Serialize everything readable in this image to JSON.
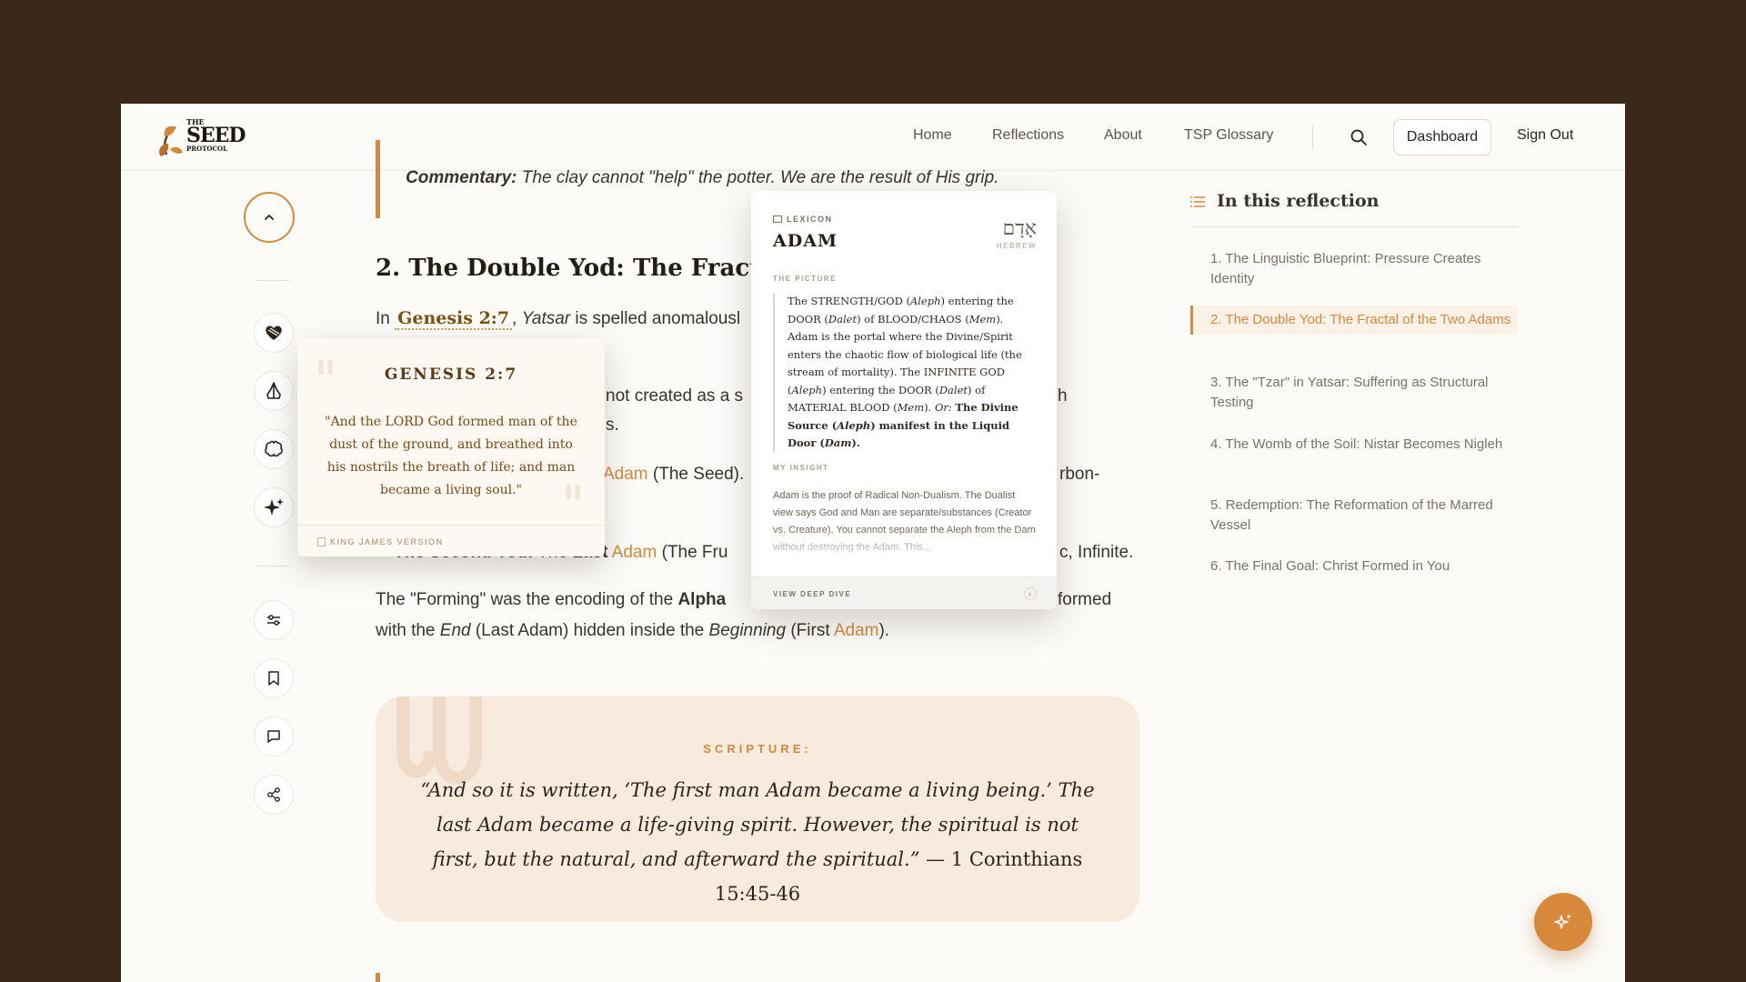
{
  "header": {
    "logo": {
      "line1": "THE",
      "line2": "SEED",
      "line3": "PROTOCOL"
    },
    "nav": [
      "Home",
      "Reflections",
      "About",
      "TSP Glossary"
    ],
    "dashboard_label": "Dashboard",
    "signout_label": "Sign Out"
  },
  "article": {
    "commentary_label": "Commentary:",
    "commentary_text": "The clay cannot \"help\" the potter. We are the result of His grip.",
    "heading": "2. The Double Yod: The Fractal o",
    "line1": {
      "pre": "In",
      "ref": "Genesis 2:7",
      "comma": ",",
      "word": "Yatsar",
      "post": "is spelled anomalousl"
    },
    "line2": {
      "a": "not created as a s",
      "b": "h"
    },
    "line3": {
      "a": "s."
    },
    "line4": {
      "adam": "Adam",
      "rest": "(The Seed).",
      "tail": "rbon-"
    },
    "line5": {
      "bullet": "•",
      "label": "The Second Yod:",
      "mid": "The",
      "last": "Last",
      "adam": "Adam",
      "rest": "(The Fru",
      "tail": "c, Infinite."
    },
    "line6": {
      "a": "The \"Forming\" was the encoding of the",
      "b": "Alpha",
      "c": "formed"
    },
    "line7": {
      "a": "with the",
      "end": "End",
      "b": "(Last Adam) hidden inside the",
      "beginning": "Beginning",
      "c": "(First",
      "adam": "Adam",
      "d": ")."
    }
  },
  "scripture": {
    "label": "SCRIPTURE:",
    "text": "“And so it is written, ‘The first man Adam became a living being.’ The last Adam became a life-giving spirit. However, the spiritual is not first, but the natural, and afterward the spiritual.”",
    "citation": "— 1 Corinthians 15:45-46"
  },
  "genesis_popup": {
    "title": "GENESIS 2:7",
    "verse": "\"And the LORD God formed man of the dust of the ground, and breathed into his nostrils the breath of life; and man became a living soul.\"",
    "version": "KING JAMES VERSION"
  },
  "lexicon_popup": {
    "kicker": "LEXICON",
    "word": "ADAM",
    "hebrew": "אָדָם",
    "hebrew_label": "HEBREW",
    "picture_label": "THE PICTURE",
    "picture": {
      "s1": "The STRENGTH/GOD (",
      "s1i": "Aleph",
      "s2": ") entering the DOOR (",
      "s2i": "Dalet",
      "s3": ") of BLOOD/CHAOS (",
      "s3i": "Mem",
      "s4": "). Adam is the portal where the Divine/Spirit enters the chaotic flow of biological life (the stream of mortality). The INFINITE GOD (",
      "s4i": "Aleph",
      "s5": ") entering the DOOR (",
      "s5i": "Dalet",
      "s6": ") of MATERIAL BLOOD (",
      "s6i": "Mem",
      "s7": ").",
      "or": "Or:",
      "b1": "The Divine Source (",
      "b1i": "Aleph",
      "b2": ") manifest in the Liquid Door (",
      "b2i": "Dam",
      "b3": ")."
    },
    "insight_label": "MY INSIGHT",
    "insight": "Adam is the proof of Radical Non-Dualism. The Dualist view says God and Man are separate/substances (Creator vs. Creature). You cannot separate the Aleph from the Dam without destroying the Adam. This...",
    "footer": "VIEW DEEP DIVE"
  },
  "toc": {
    "title": "In this reflection",
    "items": [
      "1. The Linguistic Blueprint: Pressure Creates Identity",
      "2. The Double Yod: The Fractal of the Two Adams",
      "3. The \"Tzar\" in Yatsar: Suffering as Structural Testing",
      "4. The Womb of the Soil: Nistar Becomes Nigleh",
      "5. Redemption: The Reformation of the Marred Vessel",
      "6. The Final Goal: Christ Formed in You"
    ],
    "active_index": 1
  },
  "colors": {
    "accent": "#d4893e",
    "frame": "#3a2818",
    "page": "#fcfbf8",
    "scripture_bg": "#f8eadd"
  }
}
